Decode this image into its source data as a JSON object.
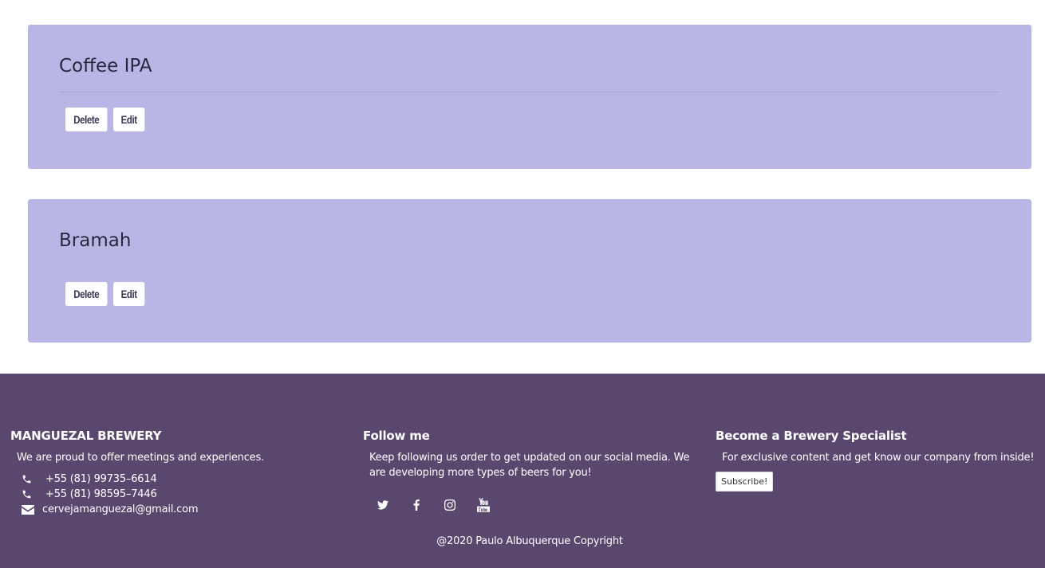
{
  "beers": [
    {
      "name": "Coffee IPA",
      "delete_label": "Delete",
      "edit_label": "Edit"
    },
    {
      "name": "Bramah",
      "delete_label": "Delete",
      "edit_label": "Edit"
    }
  ],
  "footer": {
    "brand": {
      "title": "MANGUEZAL BREWERY",
      "text": "We are proud to offer meetings and experiences.",
      "phone_1": "+55 (81) 99735–6614",
      "phone_2": "+55 (81) 98595–7446",
      "email": "cervejamanguezal@gmail.com"
    },
    "follow": {
      "title": "Follow me",
      "text": "Keep following us order to get updated on our social media. We are developing more types of beers for you!",
      "icons": [
        "twitter-icon",
        "facebook-icon",
        "instagram-icon",
        "youtube-icon"
      ]
    },
    "specialist": {
      "title": "Become a Brewery Specialist",
      "text": "For exclusive content and get know our company from inside!",
      "subscribe_label": "Subscribe!"
    },
    "copyright": "@2020 Paulo Albuquerque Copyright"
  },
  "colors": {
    "card_bg": "#b9b6e6",
    "footer_bg": "#59476e",
    "button_text": "#3d3356"
  }
}
